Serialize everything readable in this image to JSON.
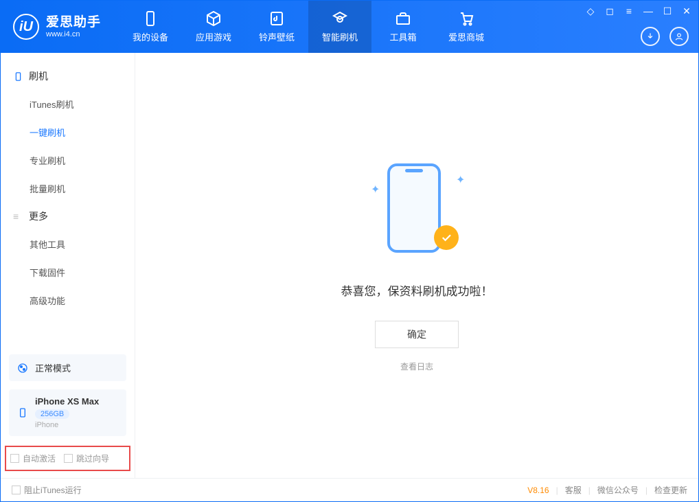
{
  "app": {
    "title": "爱思助手",
    "subtitle": "www.i4.cn",
    "logo_letter": "iU"
  },
  "tabs": {
    "device": "我的设备",
    "apps": "应用游戏",
    "media": "铃声壁纸",
    "flash": "智能刷机",
    "tools": "工具箱",
    "store": "爱思商城"
  },
  "sidebar": {
    "group_flash": "刷机",
    "itunes": "iTunes刷机",
    "oneclick": "一键刷机",
    "pro": "专业刷机",
    "batch": "批量刷机",
    "group_more": "更多",
    "other_tools": "其他工具",
    "download_fw": "下载固件",
    "advanced": "高级功能",
    "mode_normal": "正常模式",
    "device_name": "iPhone XS Max",
    "device_cap": "256GB",
    "device_type": "iPhone",
    "opt_auto_activate": "自动激活",
    "opt_skip_guide": "跳过向导"
  },
  "main": {
    "success_msg": "恭喜您，保资料刷机成功啦！",
    "ok_btn": "确定",
    "view_log": "查看日志"
  },
  "footer": {
    "block_itunes": "阻止iTunes运行",
    "version": "V8.16",
    "support": "客服",
    "wechat": "微信公众号",
    "update": "检查更新"
  }
}
